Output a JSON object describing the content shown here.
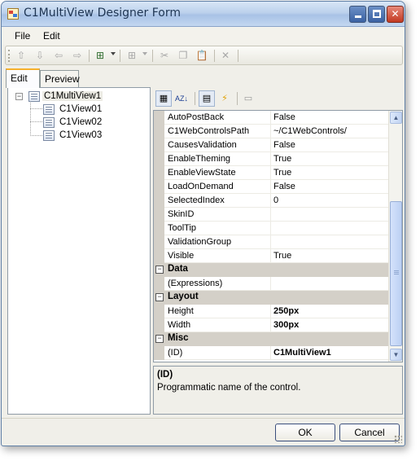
{
  "window": {
    "title": "C1MultiView Designer Form",
    "icon": "app-icon"
  },
  "menu": {
    "items": [
      {
        "label": "File"
      },
      {
        "label": "Edit"
      }
    ]
  },
  "toolbar": {
    "buttons": [
      {
        "name": "move-up-icon",
        "glyph": "⇧",
        "enabled": false
      },
      {
        "name": "move-down-icon",
        "glyph": "⇩",
        "enabled": false
      },
      {
        "name": "move-left-icon",
        "glyph": "⇦",
        "enabled": false
      },
      {
        "name": "move-right-icon",
        "glyph": "⇨",
        "enabled": false
      },
      {
        "name": "add-view-icon",
        "glyph": "⊞",
        "enabled": true
      },
      {
        "name": "insert-view-icon",
        "glyph": "⊞",
        "enabled": false
      },
      {
        "name": "cut-icon",
        "glyph": "✂",
        "enabled": false
      },
      {
        "name": "copy-icon",
        "glyph": "❐",
        "enabled": false
      },
      {
        "name": "paste-icon",
        "glyph": "📋",
        "enabled": false
      },
      {
        "name": "delete-icon",
        "glyph": "✕",
        "enabled": false
      }
    ]
  },
  "tabs": [
    {
      "label": "Edit",
      "active": true
    },
    {
      "label": "Preview",
      "active": false
    }
  ],
  "tree": {
    "root": {
      "label": "C1MultiView1",
      "expander": "−"
    },
    "children": [
      {
        "label": "C1View01"
      },
      {
        "label": "C1View02"
      },
      {
        "label": "C1View03"
      }
    ]
  },
  "property_toolbar": {
    "buttons": [
      {
        "name": "categorized-icon",
        "glyph": "▦",
        "pressed": true
      },
      {
        "name": "alphabetical-icon",
        "glyph": "AZ↓",
        "pressed": false
      },
      {
        "name": "properties-icon",
        "glyph": "▤",
        "pressed": true
      },
      {
        "name": "events-icon",
        "glyph": "⚡",
        "pressed": false
      },
      {
        "name": "property-pages-icon",
        "glyph": "▭",
        "pressed": false
      }
    ]
  },
  "property_grid": {
    "rows": [
      {
        "kind": "prop",
        "name": "AutoPostBack",
        "value": "False",
        "bold": false
      },
      {
        "kind": "prop",
        "name": "C1WebControlsPath",
        "value": "~/C1WebControls/",
        "bold": false
      },
      {
        "kind": "prop",
        "name": "CausesValidation",
        "value": "False",
        "bold": false
      },
      {
        "kind": "prop",
        "name": "EnableTheming",
        "value": "True",
        "bold": false
      },
      {
        "kind": "prop",
        "name": "EnableViewState",
        "value": "True",
        "bold": false
      },
      {
        "kind": "prop",
        "name": "LoadOnDemand",
        "value": "False",
        "bold": false
      },
      {
        "kind": "prop",
        "name": "SelectedIndex",
        "value": "0",
        "bold": false
      },
      {
        "kind": "prop",
        "name": "SkinID",
        "value": "",
        "bold": false
      },
      {
        "kind": "prop",
        "name": "ToolTip",
        "value": "",
        "bold": false
      },
      {
        "kind": "prop",
        "name": "ValidationGroup",
        "value": "",
        "bold": false
      },
      {
        "kind": "prop",
        "name": "Visible",
        "value": "True",
        "bold": false
      },
      {
        "kind": "category",
        "name": "Data",
        "expander": "−"
      },
      {
        "kind": "prop",
        "name": "(Expressions)",
        "value": "",
        "bold": false
      },
      {
        "kind": "category",
        "name": "Layout",
        "expander": "−"
      },
      {
        "kind": "prop",
        "name": "Height",
        "value": "250px",
        "bold": true
      },
      {
        "kind": "prop",
        "name": "Width",
        "value": "300px",
        "bold": true
      },
      {
        "kind": "category",
        "name": "Misc",
        "expander": "−"
      },
      {
        "kind": "prop",
        "name": "(ID)",
        "value": "C1MultiView1",
        "bold": true
      }
    ]
  },
  "description": {
    "title": "(ID)",
    "text": "Programmatic name of the control."
  },
  "dialog": {
    "ok_label": "OK",
    "cancel_label": "Cancel"
  },
  "colors": {
    "category_bg": "#d4d0c8",
    "tab_highlight": "#f6b12d",
    "titlebar": "#bcd1ec"
  }
}
